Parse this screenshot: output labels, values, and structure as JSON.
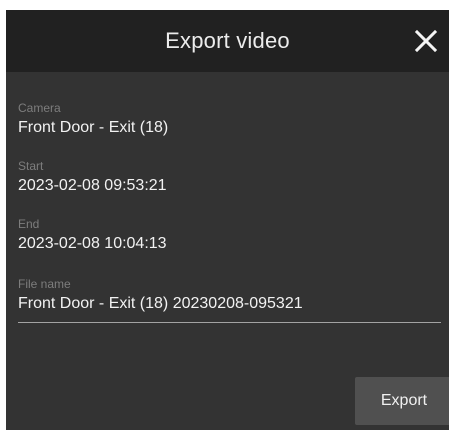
{
  "dialog": {
    "title": "Export video",
    "close_icon": "close-icon"
  },
  "fields": {
    "camera": {
      "label": "Camera",
      "value": "Front Door - Exit (18)"
    },
    "start": {
      "label": "Start",
      "value": "2023-02-08 09:53:21"
    },
    "end": {
      "label": "End",
      "value": "2023-02-08 10:04:13"
    },
    "file_name": {
      "label": "File name",
      "value": "Front Door - Exit (18) 20230208-095321"
    }
  },
  "actions": {
    "export_label": "Export"
  },
  "colors": {
    "header_bg": "#212121",
    "body_bg": "#333333",
    "button_bg": "#505050",
    "label_text": "#7d7d7d",
    "value_text": "#f2f2f2"
  }
}
